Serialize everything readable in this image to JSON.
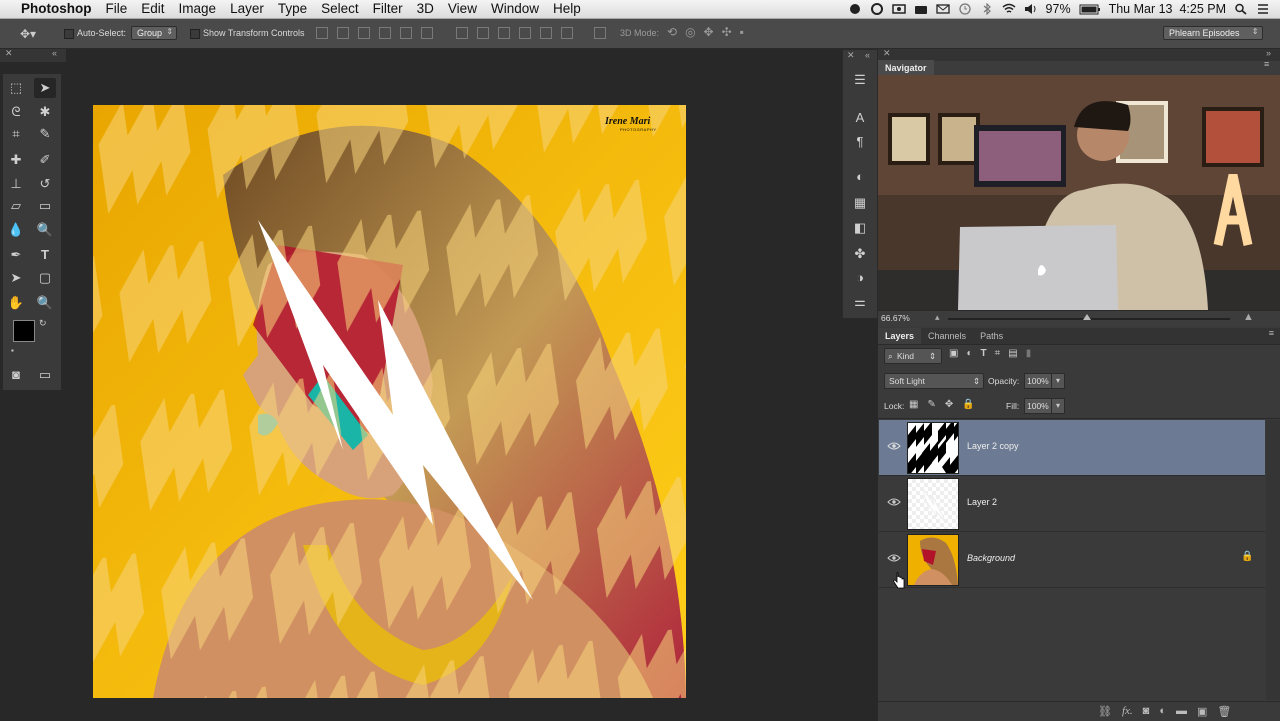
{
  "menubar": {
    "app_name": "Photoshop",
    "items": [
      "File",
      "Edit",
      "Image",
      "Layer",
      "Type",
      "Select",
      "Filter",
      "3D",
      "View",
      "Window",
      "Help"
    ],
    "battery": "97%",
    "datetime": "Thu Mar 13  4:25 PM"
  },
  "options": {
    "auto_select_label": "Auto-Select:",
    "auto_select_value": "Group",
    "show_transform_label": "Show Transform Controls",
    "mode_3d_label": "3D Mode:",
    "workspace": "Phlearn Episodes"
  },
  "canvas": {
    "watermark_name": "Irene Mari",
    "watermark_sub": "PHOTOGRAPHY"
  },
  "navigator": {
    "tab": "Navigator",
    "zoom": "66.67%"
  },
  "layers_panel": {
    "tabs": [
      "Layers",
      "Channels",
      "Paths"
    ],
    "filter": "Kind",
    "blend_mode": "Soft Light",
    "opacity_label": "Opacity:",
    "opacity_value": "100%",
    "lock_label": "Lock:",
    "fill_label": "Fill:",
    "fill_value": "100%",
    "layers": [
      {
        "name": "Layer 2 copy",
        "selected": true
      },
      {
        "name": "Layer 2",
        "selected": false
      },
      {
        "name": "Background",
        "selected": false,
        "locked": true
      }
    ],
    "footer_fx": "fx."
  },
  "colors": {
    "accent_selected": "#6c7a93",
    "canvas_yellow": "#f2b500"
  }
}
